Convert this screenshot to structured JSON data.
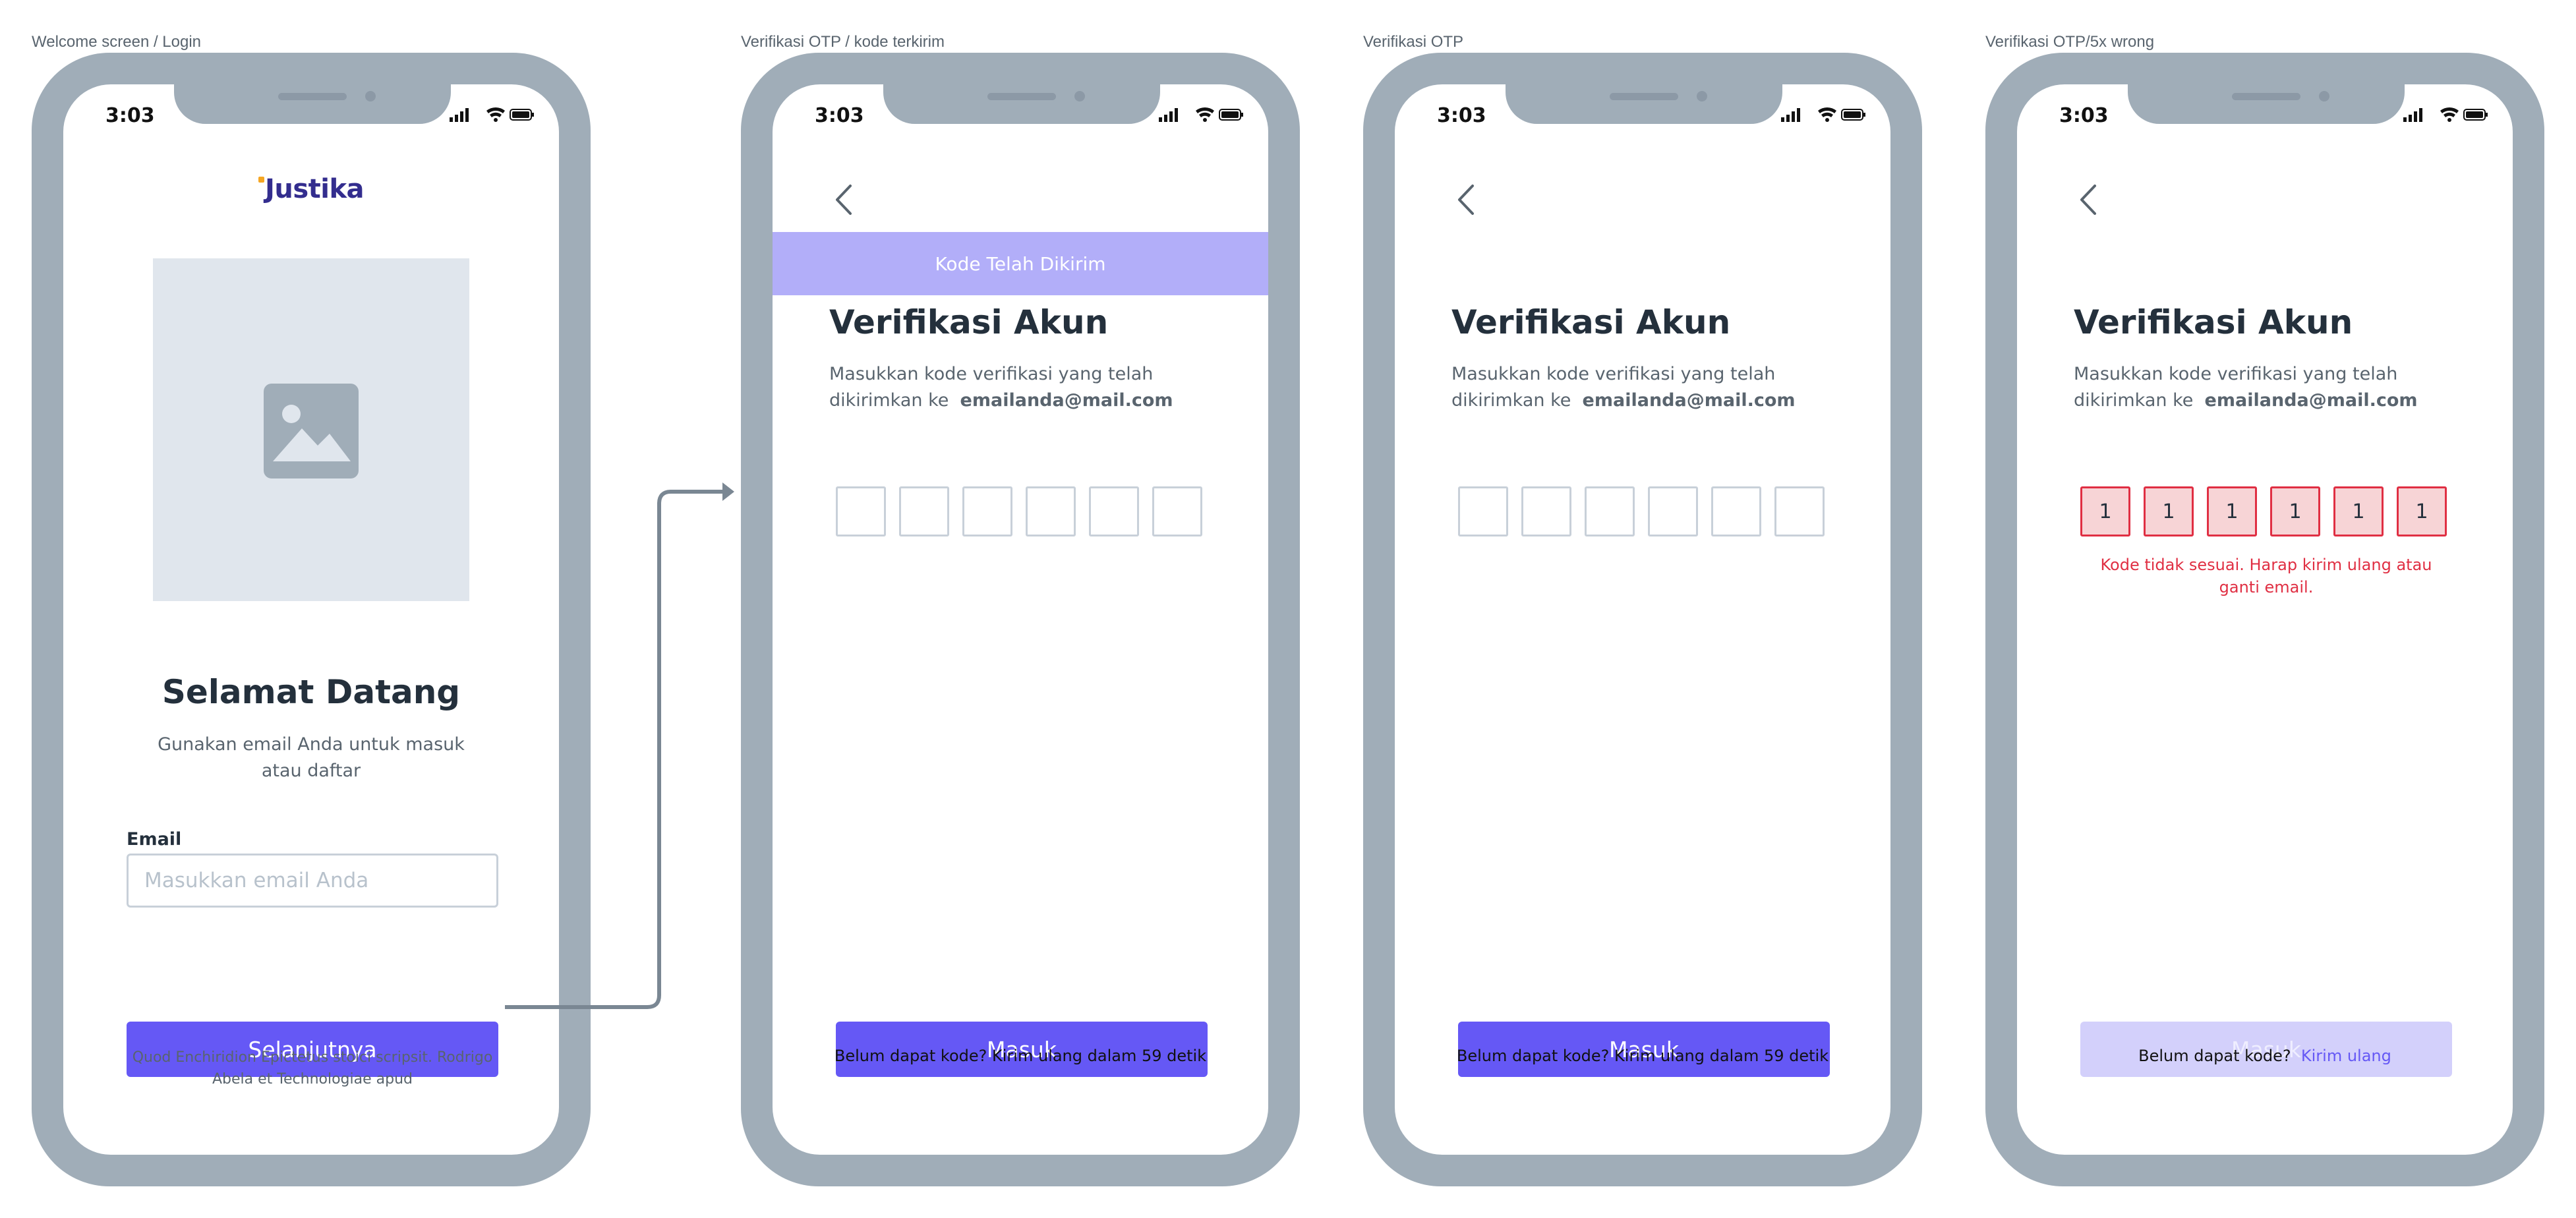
{
  "colors": {
    "phone_frame": "#a0adb8",
    "primary": "#6558f5",
    "primary_disabled": "#d3d0fb",
    "banner": "#b2aef9",
    "error": "#e02f43",
    "error_bg": "#f7d4d6",
    "text_dark": "#24303c",
    "text_muted": "#59646e",
    "placeholder_bg": "#e0e6ed"
  },
  "frames": [
    {
      "label": "Welcome screen / Login",
      "status_time": "3:03",
      "logo": "Justika",
      "image_placeholder_icon": "image-icon",
      "title": "Selamat Datang",
      "subtitle": "Gunakan email Anda untuk masuk atau daftar",
      "email_label": "Email",
      "email_placeholder": "Masukkan email Anda",
      "button": "Selanjutnya",
      "footnote": "Quod Enchiridion Epictetus stoici scripsit. Rodrigo Abela et Technologiae apud"
    },
    {
      "label": "Verifikasi OTP / kode terkirim",
      "status_time": "3:03",
      "banner": "Kode Telah Dikirim",
      "title": "Verifikasi Akun",
      "desc_prefix": "Masukkan kode verifikasi yang telah dikirimkan ke",
      "email": "emailanda@mail.com",
      "otp_digits": [
        "",
        "",
        "",
        "",
        "",
        ""
      ],
      "button": "Masuk",
      "resend_text": "Belum dapat kode? Kirim ulang dalam 59 detik"
    },
    {
      "label": "Verifikasi OTP",
      "status_time": "3:03",
      "title": "Verifikasi Akun",
      "desc_prefix": "Masukkan kode verifikasi yang telah dikirimkan ke",
      "email": "emailanda@mail.com",
      "otp_digits": [
        "",
        "",
        "",
        "",
        "",
        ""
      ],
      "button": "Masuk",
      "resend_text": "Belum dapat kode? Kirim ulang dalam 59 detik"
    },
    {
      "label": "Verifikasi OTP/5x wrong",
      "status_time": "3:03",
      "title": "Verifikasi Akun",
      "desc_prefix": "Masukkan kode verifikasi yang telah dikirimkan ke",
      "email": "emailanda@mail.com",
      "otp_digits": [
        "1",
        "1",
        "1",
        "1",
        "1",
        "1"
      ],
      "error": "Kode tidak sesuai. Harap kirim ulang atau ganti email.",
      "button": "Masuk",
      "button_disabled": true,
      "resend_prefix": "Belum dapat kode?",
      "resend_link": "Kirim ulang"
    }
  ]
}
